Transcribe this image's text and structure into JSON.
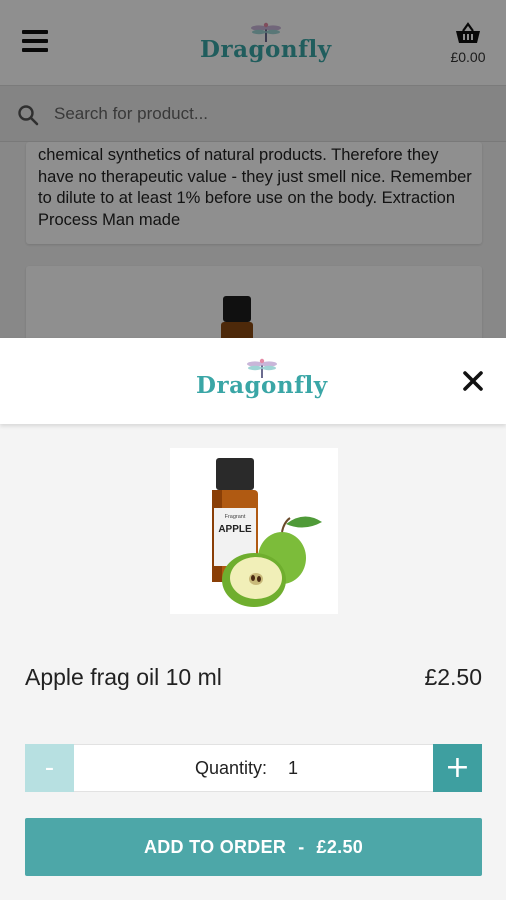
{
  "app": {
    "brand": "Dragonfly",
    "basket_total": "£0.00",
    "search_placeholder": "Search for product..."
  },
  "background": {
    "description_text": "chemical synthetics of natural products. Therefore they have no therapeutic value - they just smell nice. Remember to dilute to at least 1% before use on the body. Extraction Process Man made"
  },
  "modal": {
    "brand": "Dragonfly",
    "product_name": "Apple frag oil 10 ml",
    "product_price": "£2.50",
    "image_label_small": "Fragrant",
    "image_label_big": "APPLE",
    "quantity_label": "Quantity:",
    "quantity_value": "1",
    "minus_label": "-",
    "plus_label": "+",
    "add_label": "ADD TO ORDER",
    "add_separator": "-",
    "add_price": "£2.50"
  },
  "icons": {
    "menu": "menu-icon",
    "basket": "basket-icon",
    "search": "search-icon",
    "close": "close-icon"
  },
  "colors": {
    "brand_teal": "#3aa6a6",
    "button_teal": "#4da7a8",
    "plus_teal": "#3e9fa0",
    "minus_disabled": "#b7e0e1"
  }
}
